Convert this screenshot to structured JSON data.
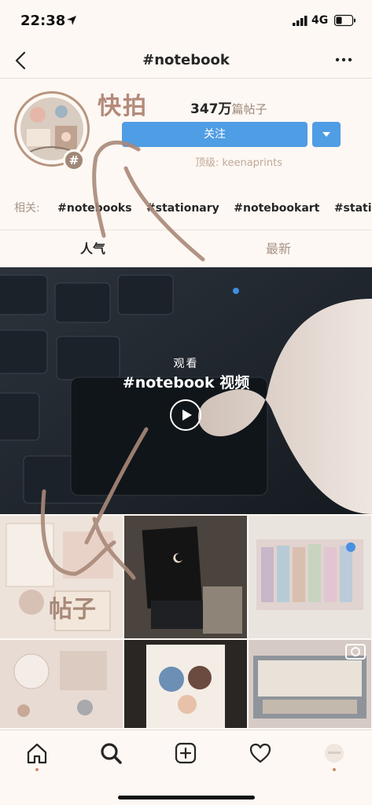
{
  "status_bar": {
    "time": "22:38",
    "network": "4G",
    "icons": [
      "location-arrow-icon",
      "signal-bars-icon",
      "battery-icon"
    ]
  },
  "nav": {
    "title": "#notebook",
    "icons": [
      "back-chevron-icon",
      "more-dots-icon"
    ]
  },
  "header": {
    "quick_label": "快拍",
    "post_count": "347万",
    "post_count_unit": "篇帖子",
    "follow_label": "关注",
    "top_account_prefix": "顶级:",
    "top_account_name": "keenaprints",
    "hash_badge": "#"
  },
  "related": {
    "label": "相关:",
    "tags": [
      "#notebooks",
      "#stationary",
      "#notebookart",
      "#stationa"
    ]
  },
  "tabs": {
    "popular": "人气",
    "recent": "最新"
  },
  "video": {
    "watch_label": "观看",
    "title": "#notebook 视频"
  },
  "annotation": {
    "posts_label": "帖子"
  },
  "tab_bar": {
    "icons": [
      "home-icon",
      "search-icon",
      "add-post-icon",
      "heart-icon",
      "profile-icon"
    ]
  },
  "colors": {
    "follow_blue": "#4f9de4",
    "scribble_brown": "#a98979",
    "background": "#fdf8f3"
  }
}
